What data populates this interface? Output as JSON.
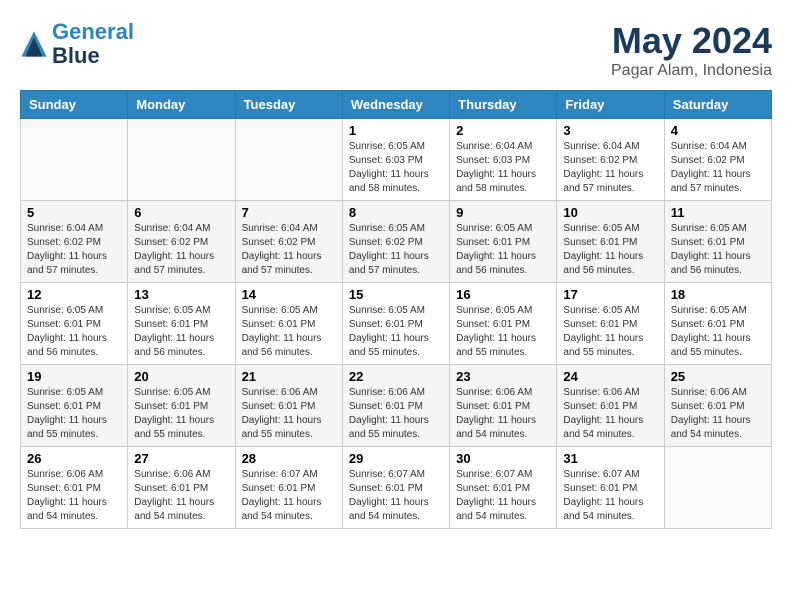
{
  "header": {
    "logo_line1": "General",
    "logo_line2": "Blue",
    "title": "May 2024",
    "subtitle": "Pagar Alam, Indonesia"
  },
  "weekdays": [
    "Sunday",
    "Monday",
    "Tuesday",
    "Wednesday",
    "Thursday",
    "Friday",
    "Saturday"
  ],
  "weeks": [
    [
      {
        "day": "",
        "info": ""
      },
      {
        "day": "",
        "info": ""
      },
      {
        "day": "",
        "info": ""
      },
      {
        "day": "1",
        "info": "Sunrise: 6:05 AM\nSunset: 6:03 PM\nDaylight: 11 hours\nand 58 minutes."
      },
      {
        "day": "2",
        "info": "Sunrise: 6:04 AM\nSunset: 6:03 PM\nDaylight: 11 hours\nand 58 minutes."
      },
      {
        "day": "3",
        "info": "Sunrise: 6:04 AM\nSunset: 6:02 PM\nDaylight: 11 hours\nand 57 minutes."
      },
      {
        "day": "4",
        "info": "Sunrise: 6:04 AM\nSunset: 6:02 PM\nDaylight: 11 hours\nand 57 minutes."
      }
    ],
    [
      {
        "day": "5",
        "info": "Sunrise: 6:04 AM\nSunset: 6:02 PM\nDaylight: 11 hours\nand 57 minutes."
      },
      {
        "day": "6",
        "info": "Sunrise: 6:04 AM\nSunset: 6:02 PM\nDaylight: 11 hours\nand 57 minutes."
      },
      {
        "day": "7",
        "info": "Sunrise: 6:04 AM\nSunset: 6:02 PM\nDaylight: 11 hours\nand 57 minutes."
      },
      {
        "day": "8",
        "info": "Sunrise: 6:05 AM\nSunset: 6:02 PM\nDaylight: 11 hours\nand 57 minutes."
      },
      {
        "day": "9",
        "info": "Sunrise: 6:05 AM\nSunset: 6:01 PM\nDaylight: 11 hours\nand 56 minutes."
      },
      {
        "day": "10",
        "info": "Sunrise: 6:05 AM\nSunset: 6:01 PM\nDaylight: 11 hours\nand 56 minutes."
      },
      {
        "day": "11",
        "info": "Sunrise: 6:05 AM\nSunset: 6:01 PM\nDaylight: 11 hours\nand 56 minutes."
      }
    ],
    [
      {
        "day": "12",
        "info": "Sunrise: 6:05 AM\nSunset: 6:01 PM\nDaylight: 11 hours\nand 56 minutes."
      },
      {
        "day": "13",
        "info": "Sunrise: 6:05 AM\nSunset: 6:01 PM\nDaylight: 11 hours\nand 56 minutes."
      },
      {
        "day": "14",
        "info": "Sunrise: 6:05 AM\nSunset: 6:01 PM\nDaylight: 11 hours\nand 56 minutes."
      },
      {
        "day": "15",
        "info": "Sunrise: 6:05 AM\nSunset: 6:01 PM\nDaylight: 11 hours\nand 55 minutes."
      },
      {
        "day": "16",
        "info": "Sunrise: 6:05 AM\nSunset: 6:01 PM\nDaylight: 11 hours\nand 55 minutes."
      },
      {
        "day": "17",
        "info": "Sunrise: 6:05 AM\nSunset: 6:01 PM\nDaylight: 11 hours\nand 55 minutes."
      },
      {
        "day": "18",
        "info": "Sunrise: 6:05 AM\nSunset: 6:01 PM\nDaylight: 11 hours\nand 55 minutes."
      }
    ],
    [
      {
        "day": "19",
        "info": "Sunrise: 6:05 AM\nSunset: 6:01 PM\nDaylight: 11 hours\nand 55 minutes."
      },
      {
        "day": "20",
        "info": "Sunrise: 6:05 AM\nSunset: 6:01 PM\nDaylight: 11 hours\nand 55 minutes."
      },
      {
        "day": "21",
        "info": "Sunrise: 6:06 AM\nSunset: 6:01 PM\nDaylight: 11 hours\nand 55 minutes."
      },
      {
        "day": "22",
        "info": "Sunrise: 6:06 AM\nSunset: 6:01 PM\nDaylight: 11 hours\nand 55 minutes."
      },
      {
        "day": "23",
        "info": "Sunrise: 6:06 AM\nSunset: 6:01 PM\nDaylight: 11 hours\nand 54 minutes."
      },
      {
        "day": "24",
        "info": "Sunrise: 6:06 AM\nSunset: 6:01 PM\nDaylight: 11 hours\nand 54 minutes."
      },
      {
        "day": "25",
        "info": "Sunrise: 6:06 AM\nSunset: 6:01 PM\nDaylight: 11 hours\nand 54 minutes."
      }
    ],
    [
      {
        "day": "26",
        "info": "Sunrise: 6:06 AM\nSunset: 6:01 PM\nDaylight: 11 hours\nand 54 minutes."
      },
      {
        "day": "27",
        "info": "Sunrise: 6:06 AM\nSunset: 6:01 PM\nDaylight: 11 hours\nand 54 minutes."
      },
      {
        "day": "28",
        "info": "Sunrise: 6:07 AM\nSunset: 6:01 PM\nDaylight: 11 hours\nand 54 minutes."
      },
      {
        "day": "29",
        "info": "Sunrise: 6:07 AM\nSunset: 6:01 PM\nDaylight: 11 hours\nand 54 minutes."
      },
      {
        "day": "30",
        "info": "Sunrise: 6:07 AM\nSunset: 6:01 PM\nDaylight: 11 hours\nand 54 minutes."
      },
      {
        "day": "31",
        "info": "Sunrise: 6:07 AM\nSunset: 6:01 PM\nDaylight: 11 hours\nand 54 minutes."
      },
      {
        "day": "",
        "info": ""
      }
    ]
  ]
}
